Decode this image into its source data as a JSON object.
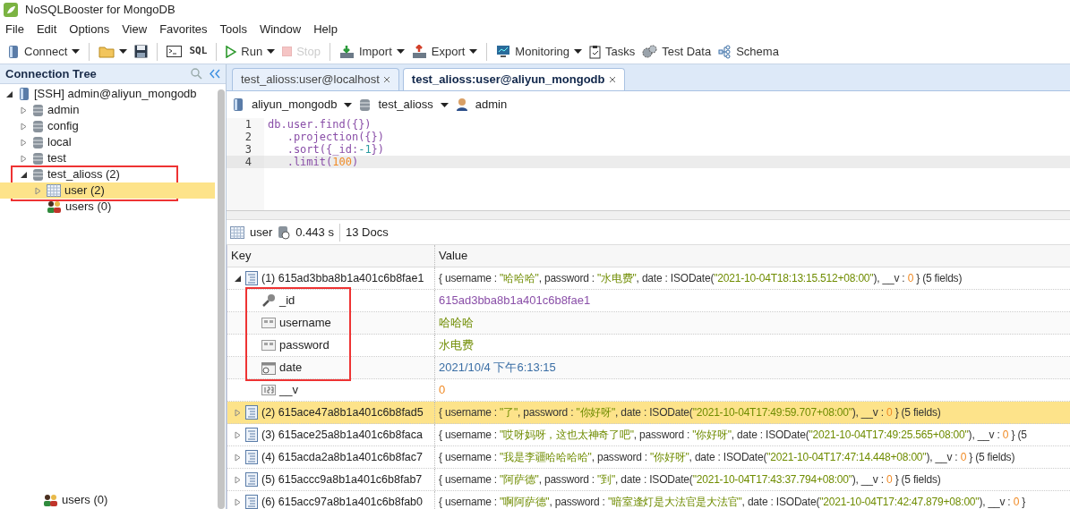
{
  "window": {
    "title": "NoSQLBooster for MongoDB"
  },
  "menu": [
    "File",
    "Edit",
    "Options",
    "View",
    "Favorites",
    "Tools",
    "Window",
    "Help"
  ],
  "toolbar": [
    {
      "label": "Connect",
      "kind": "connect",
      "dropdown": true,
      "disabled": false
    },
    {
      "kind": "folder",
      "dropdown": true,
      "disabled": false
    },
    {
      "kind": "save",
      "dropdown": false,
      "disabled": false
    },
    {
      "kind": "shell",
      "dropdown": false,
      "disabled": false
    },
    {
      "label": "SQL",
      "kind": "sql",
      "dropdown": false,
      "disabled": false
    },
    {
      "label": "Run",
      "kind": "run",
      "dropdown": true,
      "disabled": false
    },
    {
      "label": "Stop",
      "kind": "stop",
      "dropdown": false,
      "disabled": true
    },
    {
      "label": "Import",
      "kind": "import",
      "dropdown": true,
      "disabled": false
    },
    {
      "label": "Export",
      "kind": "export",
      "dropdown": true,
      "disabled": false
    },
    {
      "label": "Monitoring",
      "kind": "monitor",
      "dropdown": true,
      "disabled": false
    },
    {
      "label": "Tasks",
      "kind": "tasks",
      "dropdown": false,
      "disabled": false
    },
    {
      "label": "Test Data",
      "kind": "gears",
      "dropdown": false,
      "disabled": false
    },
    {
      "label": "Schema",
      "kind": "schema",
      "dropdown": false,
      "disabled": false
    }
  ],
  "sidebar": {
    "title": "Connection Tree",
    "annotation_frame": true,
    "tree": [
      {
        "label": "[SSH] admin@aliyun_mongodb",
        "kind": "server",
        "expanded": true,
        "selected": false,
        "children": [
          {
            "label": "admin",
            "kind": "db",
            "expanded": false,
            "selected": false
          },
          {
            "label": "config",
            "kind": "db",
            "expanded": false,
            "selected": false
          },
          {
            "label": "local",
            "kind": "db",
            "expanded": false,
            "selected": false
          },
          {
            "label": "test",
            "kind": "db",
            "expanded": false,
            "selected": false
          },
          {
            "label": "test_alioss (2)",
            "kind": "db",
            "expanded": true,
            "selected": false,
            "children": [
              {
                "label": "user (2)",
                "kind": "collection",
                "expanded": false,
                "selected": true
              },
              {
                "label": "users (0)",
                "kind": "users",
                "selected": false
              }
            ]
          }
        ]
      }
    ],
    "footer_item": {
      "label": "users (0)",
      "kind": "users"
    }
  },
  "tabs": [
    {
      "label": "test_alioss:user@localhost",
      "selected": false
    },
    {
      "label": "test_alioss:user@aliyun_mongodb",
      "selected": true
    }
  ],
  "context": {
    "server": "aliyun_mongodb",
    "database": "test_alioss",
    "user": "admin"
  },
  "editor": {
    "lines": [
      {
        "number": "1",
        "current": false,
        "segments": [
          {
            "t": "db.user.find({})",
            "kind": "code"
          }
        ]
      },
      {
        "number": "2",
        "current": false,
        "segments": [
          {
            "t": "   .projection({})",
            "kind": "code"
          }
        ]
      },
      {
        "number": "3",
        "current": false,
        "segments": [
          {
            "t": "   .sort({_id:",
            "kind": "code"
          },
          {
            "t": "-1",
            "kind": "neg"
          },
          {
            "t": "})",
            "kind": "code"
          }
        ]
      },
      {
        "number": "4",
        "current": true,
        "segments": [
          {
            "t": "   .limit(",
            "kind": "code"
          },
          {
            "t": "100",
            "kind": "num"
          },
          {
            "t": ")",
            "kind": "code"
          }
        ]
      }
    ]
  },
  "result_bar": {
    "collection": "user",
    "time": "0.443 s",
    "count": "13 Docs"
  },
  "table": {
    "columns": [
      "Key",
      "Value"
    ],
    "rows": [
      {
        "key": "(1) 615ad3bba8b1a401c6b8fae1",
        "expanded": true,
        "selected": false,
        "annotation_frame": true,
        "value": [
          {
            "t": "{ username : ",
            "kind": "plain"
          },
          {
            "t": "\"哈哈哈\"",
            "kind": "str"
          },
          {
            "t": ", password : ",
            "kind": "plain"
          },
          {
            "t": "\"水电费\"",
            "kind": "str"
          },
          {
            "t": ", date : ISODate(",
            "kind": "plain"
          },
          {
            "t": "\"2021-10-04T18:13:15.512+08:00\"",
            "kind": "str"
          },
          {
            "t": "), __v : ",
            "kind": "plain"
          },
          {
            "t": "0",
            "kind": "num"
          },
          {
            "t": " } (5 fields)",
            "kind": "plain"
          }
        ],
        "fields": [
          {
            "name": "_id",
            "kind": "key",
            "value": "615ad3bba8b1a401c6b8fae1"
          },
          {
            "name": "username",
            "kind": "string",
            "value": "哈哈哈"
          },
          {
            "name": "password",
            "kind": "string",
            "value": "水电费"
          },
          {
            "name": "date",
            "kind": "date",
            "value": "2021/10/4 下午6:13:15"
          },
          {
            "name": "__v",
            "kind": "int",
            "value": "0"
          }
        ]
      },
      {
        "key": "(2) 615ace47a8b1a401c6b8fad5",
        "expanded": false,
        "selected": true,
        "value": [
          {
            "t": "{ username : ",
            "kind": "plain"
          },
          {
            "t": "\"了\"",
            "kind": "str"
          },
          {
            "t": ", password : ",
            "kind": "plain"
          },
          {
            "t": "\"你好呀\"",
            "kind": "str"
          },
          {
            "t": ", date : ISODate(",
            "kind": "plain"
          },
          {
            "t": "\"2021-10-04T17:49:59.707+08:00\"",
            "kind": "str"
          },
          {
            "t": "), __v : ",
            "kind": "plain"
          },
          {
            "t": "0",
            "kind": "num"
          },
          {
            "t": " } (5 fields)",
            "kind": "plain"
          }
        ]
      },
      {
        "key": "(3) 615ace25a8b1a401c6b8faca",
        "expanded": false,
        "selected": false,
        "value": [
          {
            "t": "{ username : ",
            "kind": "plain"
          },
          {
            "t": "\"哎呀妈呀，这也太神奇了吧\"",
            "kind": "str"
          },
          {
            "t": ", password : ",
            "kind": "plain"
          },
          {
            "t": "\"你好呀\"",
            "kind": "str"
          },
          {
            "t": ", date : ISODate(",
            "kind": "plain"
          },
          {
            "t": "\"2021-10-04T17:49:25.565+08:00\"",
            "kind": "str"
          },
          {
            "t": "), __v : ",
            "kind": "plain"
          },
          {
            "t": "0",
            "kind": "num"
          },
          {
            "t": " } (5",
            "kind": "plain"
          }
        ]
      },
      {
        "key": "(4) 615acda2a8b1a401c6b8fac7",
        "expanded": false,
        "selected": false,
        "value": [
          {
            "t": "{ username : ",
            "kind": "plain"
          },
          {
            "t": "\"我是李疆哈哈哈哈\"",
            "kind": "str"
          },
          {
            "t": ", password : ",
            "kind": "plain"
          },
          {
            "t": "\"你好呀\"",
            "kind": "str"
          },
          {
            "t": ", date : ISODate(",
            "kind": "plain"
          },
          {
            "t": "\"2021-10-04T17:47:14.448+08:00\"",
            "kind": "str"
          },
          {
            "t": "), __v : ",
            "kind": "plain"
          },
          {
            "t": "0",
            "kind": "num"
          },
          {
            "t": " } (5 fields)",
            "kind": "plain"
          }
        ]
      },
      {
        "key": "(5) 615accc9a8b1a401c6b8fab7",
        "expanded": false,
        "selected": false,
        "value": [
          {
            "t": "{ username : ",
            "kind": "plain"
          },
          {
            "t": "\"阿萨德\"",
            "kind": "str"
          },
          {
            "t": ", password : ",
            "kind": "plain"
          },
          {
            "t": "\"到\"",
            "kind": "str"
          },
          {
            "t": ", date : ISODate(",
            "kind": "plain"
          },
          {
            "t": "\"2021-10-04T17:43:37.794+08:00\"",
            "kind": "str"
          },
          {
            "t": "), __v : ",
            "kind": "plain"
          },
          {
            "t": "0",
            "kind": "num"
          },
          {
            "t": " } (5 fields)",
            "kind": "plain"
          }
        ]
      },
      {
        "key": "(6) 615acc97a8b1a401c6b8fab0",
        "expanded": false,
        "selected": false,
        "value": [
          {
            "t": "{ username : ",
            "kind": "plain"
          },
          {
            "t": "\"啊阿萨德\"",
            "kind": "str"
          },
          {
            "t": ", password : ",
            "kind": "plain"
          },
          {
            "t": "\"暗室逢灯是大法官是大法官\"",
            "kind": "str"
          },
          {
            "t": ", date : ISODate(",
            "kind": "plain"
          },
          {
            "t": "\"2021-10-04T17:42:47.879+08:00\"",
            "kind": "str"
          },
          {
            "t": "), __v : ",
            "kind": "plain"
          },
          {
            "t": "0",
            "kind": "num"
          },
          {
            "t": " }",
            "kind": "plain"
          }
        ]
      }
    ]
  }
}
